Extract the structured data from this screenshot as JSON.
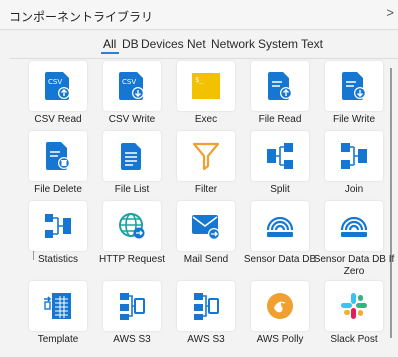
{
  "header": {
    "title": "コンポーネントライブラリ",
    "close_label": ">"
  },
  "tabs": [
    {
      "label": "All"
    },
    {
      "label": "DB"
    },
    {
      "label": "Devices"
    },
    {
      "label": "Net"
    },
    {
      "label": "Network"
    },
    {
      "label": "System"
    },
    {
      "label": "Text"
    }
  ],
  "components": [
    {
      "label": "CSV Read",
      "icon": "csv-read-icon"
    },
    {
      "label": "CSV Write",
      "icon": "csv-write-icon"
    },
    {
      "label": "Exec",
      "icon": "exec-icon"
    },
    {
      "label": "File Read",
      "icon": "file-read-icon"
    },
    {
      "label": "File Write",
      "icon": "file-write-icon"
    },
    {
      "label": "File Delete",
      "icon": "file-delete-icon"
    },
    {
      "label": "File List",
      "icon": "file-list-icon"
    },
    {
      "label": "Filter",
      "icon": "filter-icon"
    },
    {
      "label": "Split",
      "icon": "split-icon"
    },
    {
      "label": "Join",
      "icon": "join-icon"
    },
    {
      "label": "Statistics",
      "icon": "statistics-icon"
    },
    {
      "label": "HTTP Request",
      "icon": "globe-icon"
    },
    {
      "label": "Mail Send",
      "icon": "mail-send-icon"
    },
    {
      "label": "Sensor Data DB",
      "icon": "sensor-icon"
    },
    {
      "label": "Sensor Data DB If Zero",
      "icon": "sensor-icon"
    },
    {
      "label": "Template",
      "icon": "template-icon"
    },
    {
      "label": "AWS S3",
      "icon": "aws-s3-icon"
    },
    {
      "label": "AWS S3",
      "icon": "aws-s3-icon"
    },
    {
      "label": "AWS Polly",
      "icon": "aws-polly-icon"
    },
    {
      "label": "Slack Post",
      "icon": "slack-icon"
    }
  ],
  "colors": {
    "accent": "#2b7fd6",
    "icon_blue": "#1677d2",
    "exec_yellow": "#f2c200",
    "filter_orange": "#f0a030",
    "slack_pink": "#e01e5a"
  }
}
